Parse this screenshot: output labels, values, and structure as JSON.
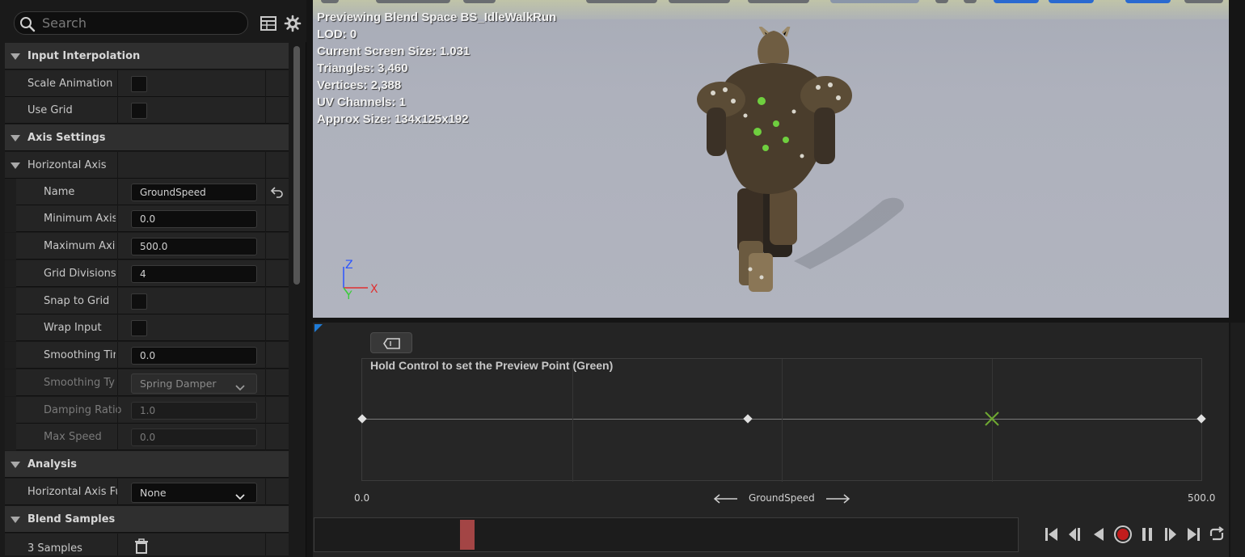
{
  "search": {
    "placeholder": "Search"
  },
  "details": {
    "sections": [
      {
        "label": "Input Interpolation"
      },
      {
        "label": "Axis Settings"
      },
      {
        "label": "Analysis"
      },
      {
        "label": "Blend Samples"
      }
    ],
    "scale_animation": {
      "label": "Scale Animation"
    },
    "use_grid": {
      "label": "Use Grid"
    },
    "horizontal_axis": {
      "label": "Horizontal Axis"
    },
    "name": {
      "label": "Name",
      "value": "GroundSpeed"
    },
    "min_axis": {
      "label": "Minimum Axis Value",
      "value": "0.0"
    },
    "max_axis": {
      "label": "Maximum Axis Value",
      "value": "500.0"
    },
    "grid_divisions": {
      "label": "Grid Divisions",
      "value": "4"
    },
    "snap_to_grid": {
      "label": "Snap to Grid"
    },
    "wrap_input": {
      "label": "Wrap Input"
    },
    "smoothing_time": {
      "label": "Smoothing Time",
      "value": "0.0"
    },
    "smoothing_type": {
      "label": "Smoothing Type",
      "value": "Spring Damper"
    },
    "damping_ratio": {
      "label": "Damping Ratio",
      "value": "1.0"
    },
    "max_speed": {
      "label": "Max Speed",
      "value": "0.0"
    },
    "horizontal_axis_function": {
      "label": "Horizontal Axis Function",
      "value": "None"
    },
    "samples": {
      "label": "3 Samples"
    }
  },
  "viewport": {
    "info": [
      "Previewing Blend Space BS_IdleWalkRun",
      "LOD: 0",
      "Current Screen Size: 1.031",
      "Triangles: 3,460",
      "Vertices: 2,388",
      "UV Channels: 1",
      "Approx Size: 134x125x192"
    ],
    "axis_labels": {
      "z": "Z",
      "x": "X",
      "y": "Y"
    }
  },
  "blendspace": {
    "hint": "Hold Control to set the Preview Point (Green)",
    "axis_name": "GroundSpeed",
    "axis_min": "0.0",
    "axis_max": "500.0",
    "grid_divisions": 4,
    "sample_values": [
      0.0,
      230.0,
      500.0
    ],
    "preview_value": 375.0,
    "preview_color": "#6fa832",
    "timeline_position": 0.21
  },
  "colors": {
    "accent": "#1f7bd6",
    "record": "#c21c1c",
    "playhead": "#a34545"
  }
}
